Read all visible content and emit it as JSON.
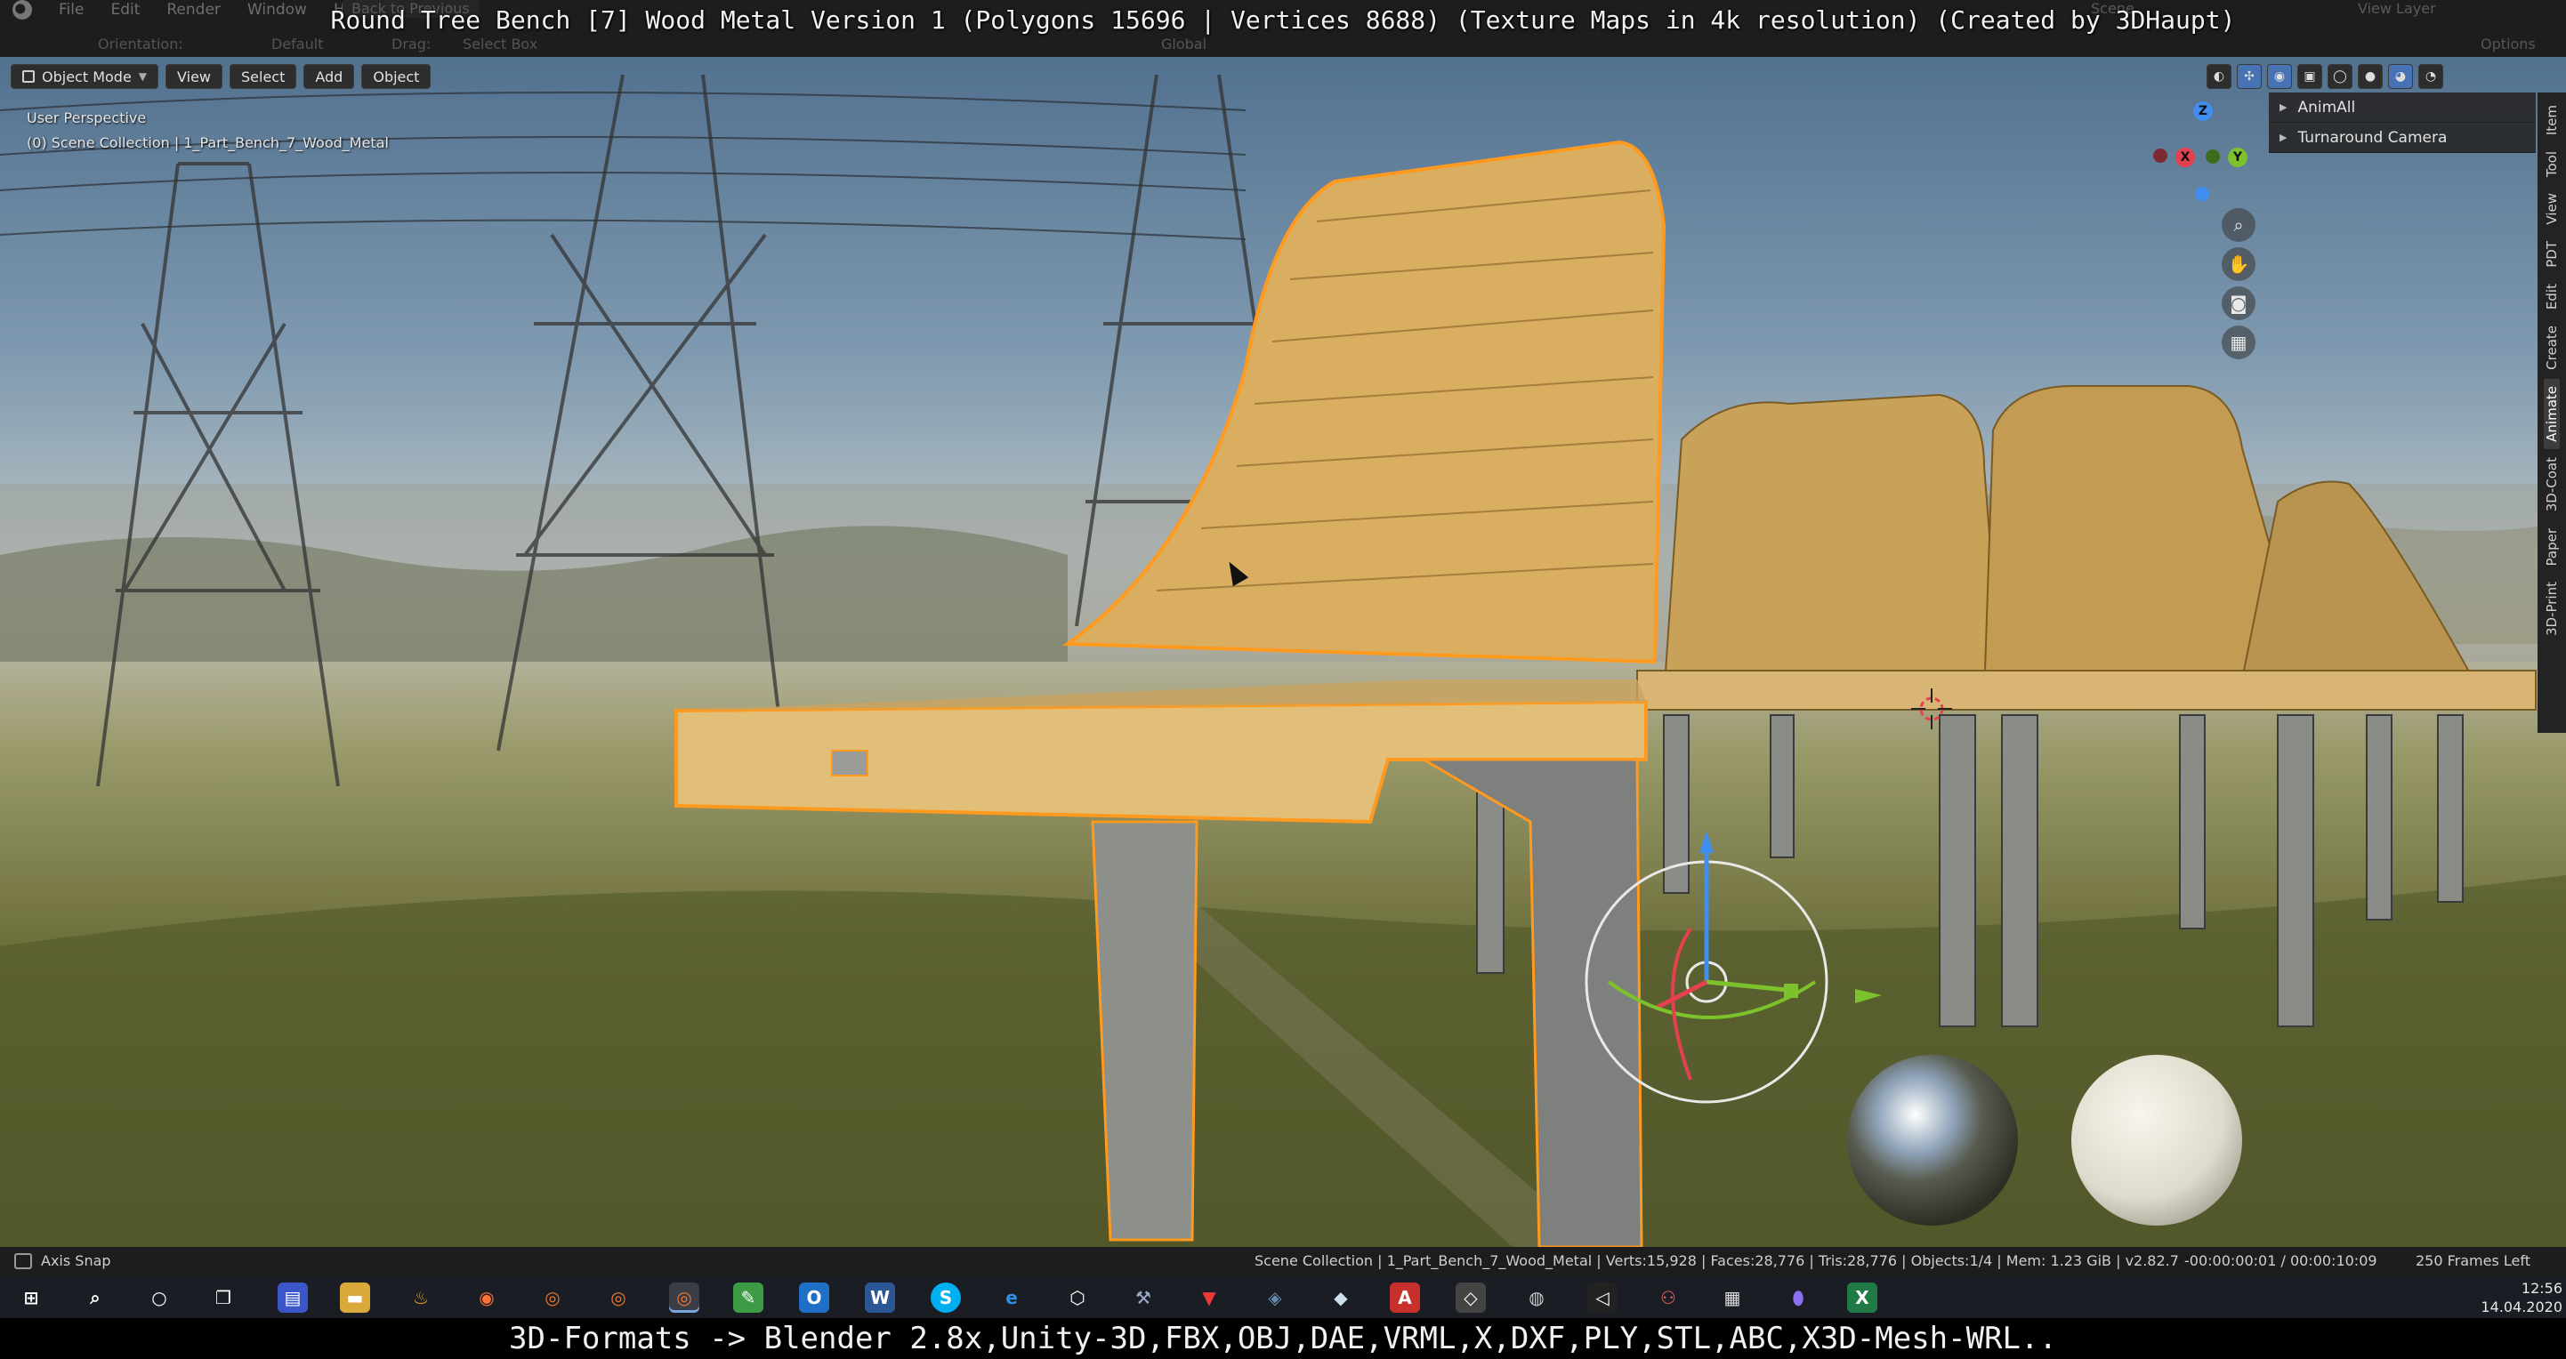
{
  "app": {
    "title_overlay": "Round Tree Bench [7] Wood Metal Version 1 (Polygons 15696 | Vertices 8688) (Texture Maps in 4k resolution) (Created by 3DHaupt)",
    "bottom_caption": "3D-Formats -> Blender 2.8x,Unity-3D,FBX,OBJ,DAE,VRML,X,DXF,PLY,STL,ABC,X3D-Mesh-WRL.."
  },
  "menu": {
    "items": [
      "File",
      "Edit",
      "Render",
      "Window",
      "Help"
    ],
    "back_to_previous": "Back to Previous",
    "scene": "Scene",
    "view_layer": "View Layer"
  },
  "toolbar": {
    "orientation_label": "Orientation:",
    "orientation_value": "Default",
    "drag_label": "Drag:",
    "drag_value": "Select Box",
    "pivot_value": "Global",
    "options_label": "Options"
  },
  "viewport": {
    "mode": "Object Mode",
    "menus": [
      "View",
      "Select",
      "Add",
      "Object"
    ],
    "perspective": "User Perspective",
    "collection_path": "(0) Scene Collection | 1_Part_Bench_7_Wood_Metal",
    "axes": {
      "x": "X",
      "y": "Y",
      "z": "Z"
    },
    "nav_icons": [
      "zoom-icon",
      "hand-pan-icon",
      "camera-icon",
      "grid-icon"
    ],
    "panel_items": [
      "AnimAll",
      "Turnaround Camera"
    ],
    "side_tabs": [
      "Item",
      "Tool",
      "View",
      "PDT",
      "Edit",
      "Create",
      "Animate",
      "3D-Coat",
      "Paper",
      "3D-Print"
    ]
  },
  "status": {
    "axis_snap": "Axis Snap",
    "info": "Scene Collection | 1_Part_Bench_7_Wood_Metal | Verts:15,928 | Faces:28,776 | Tris:28,776 | Objects:1/4 | Mem: 1.23 GiB | v2.82.7",
    "frames": "-00:00:00:01 / 00:00:10:09",
    "total_frames": "250 Frames Left"
  },
  "taskbar": {
    "time": "12:56",
    "date": "14.04.2020",
    "apps": [
      "windows-start-icon",
      "search-icon",
      "cortana-icon",
      "task-view-icon",
      "save-app-icon",
      "file-explorer-icon",
      "fire-app-icon",
      "firefox-icon",
      "blender-icon",
      "blender-icon",
      "blender-icon",
      "notepad-icon",
      "outlook-icon",
      "word-icon",
      "skype-icon",
      "edge-icon",
      "box-3d-icon",
      "tools-icon",
      "vivaldi-icon",
      "paint-icon",
      "sketchup-icon",
      "acrobat-icon",
      "unity-icon",
      "obs-icon",
      "unity-dark-icon",
      "gamepad-icon",
      "calculator-icon",
      "maps-icon",
      "excel-icon"
    ]
  },
  "colors": {
    "selection_outline": "#ff9a1f",
    "active_blue": "#4772b3",
    "axis_x": "#e5404f",
    "axis_y": "#7cc22c",
    "axis_z": "#3f8ef0"
  }
}
